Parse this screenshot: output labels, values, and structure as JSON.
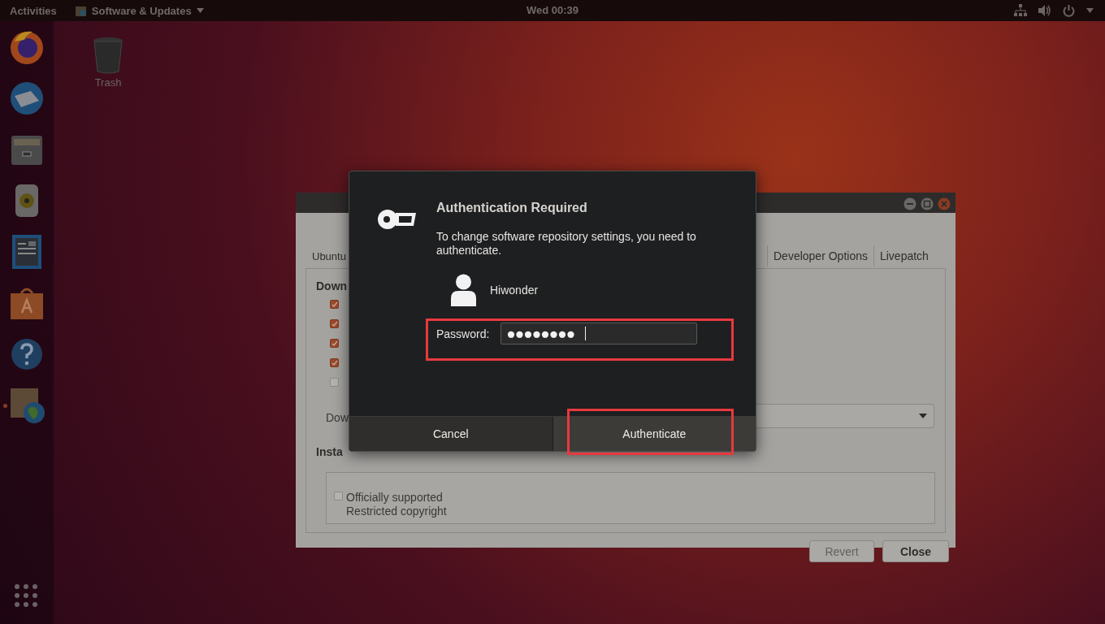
{
  "top_bar": {
    "activities": "Activities",
    "app_menu": "Software & Updates",
    "clock": "Wed 00:39"
  },
  "dock": {
    "items": [
      {
        "kind": "browser",
        "running": false
      },
      {
        "kind": "mail",
        "running": false
      },
      {
        "kind": "files",
        "running": false
      },
      {
        "kind": "music",
        "running": false
      },
      {
        "kind": "document",
        "running": false
      },
      {
        "kind": "store",
        "running": false
      },
      {
        "kind": "help",
        "running": false
      },
      {
        "kind": "updates",
        "running": true
      }
    ]
  },
  "desktop": {
    "icons": [
      {
        "label": "Trash"
      }
    ]
  },
  "window": {
    "tabs_left": [
      "Ubuntu"
    ],
    "tabs_right": [
      "Developer Options",
      "Livepatch"
    ],
    "section_downloadable": "Down",
    "sources": [
      {
        "checked": true
      },
      {
        "checked": true
      },
      {
        "checked": true
      },
      {
        "checked": true
      },
      {
        "checked": false
      }
    ],
    "download_from_label": "Dow",
    "section_install": "Insta",
    "install_option": {
      "checked": false,
      "lines": [
        "Officially supported",
        "Restricted copyright"
      ]
    },
    "buttons": [
      {
        "label": "Revert",
        "disabled": true
      },
      {
        "label": "Close",
        "disabled": false
      }
    ]
  },
  "dialog": {
    "title": "Authentication Required",
    "message": "To change software repository settings, you need to authenticate.",
    "user": "Hiwonder",
    "password_label": "Password:",
    "password_value": "●●●●●●●●",
    "buttons": [
      {
        "label": "Cancel",
        "highlighted": false
      },
      {
        "label": "Authenticate",
        "highlighted": true
      }
    ],
    "field_highlighted": true
  }
}
